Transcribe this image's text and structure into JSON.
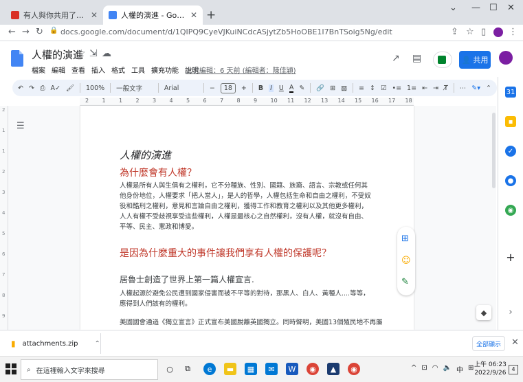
{
  "browser": {
    "tabs": [
      {
        "title": "有人與你共用了文件：「小組討論…",
        "favicon_color": "#d93025"
      },
      {
        "title": "人權的演進 - Google 文件",
        "favicon_color": "#4285f4"
      }
    ],
    "url": "docs.google.com/document/d/1QIPQ9CyeVJKuiNCdcASjytZb5HoOBE1I7BnTSoig5Ng/edit"
  },
  "docs": {
    "title": "人權的演進",
    "menus": [
      "檔案",
      "編輯",
      "查看",
      "插入",
      "格式",
      "工具",
      "擴充功能",
      "說明"
    ],
    "last_edit": "上次編輯：6 天前 (編輯者：陳佳穎)",
    "share_label": "共用"
  },
  "toolbar": {
    "zoom": "100%",
    "style": "一般文字",
    "font": "Arial",
    "font_size": "18",
    "minus": "−",
    "plus": "+"
  },
  "ruler": [
    "2",
    "1",
    "1",
    "2",
    "3",
    "4",
    "5",
    "6",
    "7",
    "8",
    "9",
    "10",
    "11",
    "12",
    "13",
    "14",
    "15",
    "16",
    "17",
    "18"
  ],
  "vruler": [
    "2",
    "1",
    "1",
    "2",
    "3",
    "4",
    "5",
    "6",
    "7",
    "8",
    "9",
    "10"
  ],
  "content": {
    "title": "人權的演進",
    "heading1": "為什麼會有人權？",
    "para1": "人權是所有人與生俱有之權利，它不分種族、性別、國籍、族裔、語言、宗教或任何其他身份地位，人權要求「把人當人」，是人的哲學，人權包括生命和自由之權利，不受奴役和酷刑之權利，意見和言論自由之權利，獲得工作和教育之權利以及其他更多權利，人人有權不受歧視享受這些權利，人權是最核心之自然權利，沒有人權，就沒有自由、平等、民主、憲政和博愛。",
    "heading2": "是因為什麼重大的事件讓我們享有人權的保護呢？",
    "heading3": "居魯士創造了世界上第一篇人權宣言.",
    "para2": "人權起源於避免公民遭到國家侵害而被不平等的對待，那黑人、白人、黃種人....等等，應得到人們該有的權利。",
    "para3": "美國國會通過《獨立宣言》正式宣布美國脫離英國獨立。同時聲明，美國13個殖民地不再屬"
  },
  "downloads": {
    "file": "attachments.zip",
    "show_all": "全部顯示"
  },
  "taskbar": {
    "search_placeholder": "在這裡輸入文字來搜尋",
    "time": "上午 06:23",
    "date": "2022/9/26",
    "ime": "中",
    "notifications": "4"
  },
  "colors": {
    "accent": "#1a73e8",
    "heading_red": "#c0392b",
    "avatar": "#7b1fa2"
  }
}
